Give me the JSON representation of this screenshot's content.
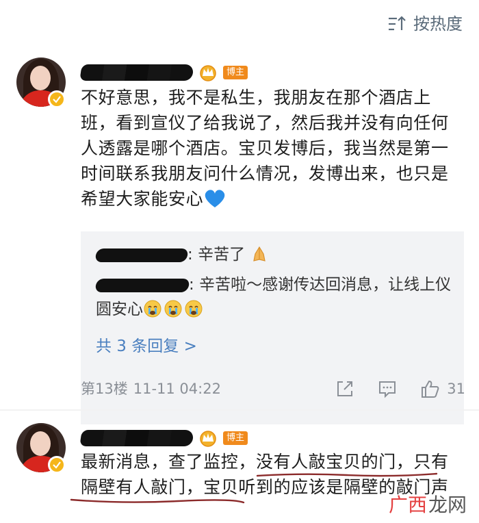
{
  "sort": {
    "label": "按热度",
    "icon": "sort-icon"
  },
  "comments": [
    {
      "author_badge": "博主",
      "text": "不好意思，我不是私生，我朋友在那个酒店上班，看到宣仪了给我说了，然后我并没有向任何人透露是哪个酒店。宝贝发博后，我当然是第一时间联系我朋友问什么情况，发博出来，也只是希望大家能安心",
      "text_emoji": "blue-heart-icon",
      "replies": [
        {
          "text": "辛苦了",
          "emoji": "pray-hands-icon"
        },
        {
          "text": "辛苦啦～感谢传达回消息，让线上仪圆安心",
          "emoji": "crying-face-icon"
        }
      ],
      "more_replies_label": "共 3 条回复 >",
      "floor": "第13楼",
      "time": "11-11 04:22",
      "likes": "31"
    },
    {
      "author_badge": "博主",
      "text_part1": "最新消息，查了监控",
      "text_part2": "，没有人敲宝贝的门，",
      "text_part3": "只有隔壁有人敲门",
      "text_part4": "，宝贝听到的应该是隔壁",
      "text_part5": "的敲门声"
    }
  ],
  "watermark": {
    "part1": "广西",
    "part2": "龙网"
  },
  "colors": {
    "badge": "#f08a1c",
    "link": "#4a7fbf",
    "meta": "#8a8f96",
    "underline": "#8b2a2a"
  }
}
